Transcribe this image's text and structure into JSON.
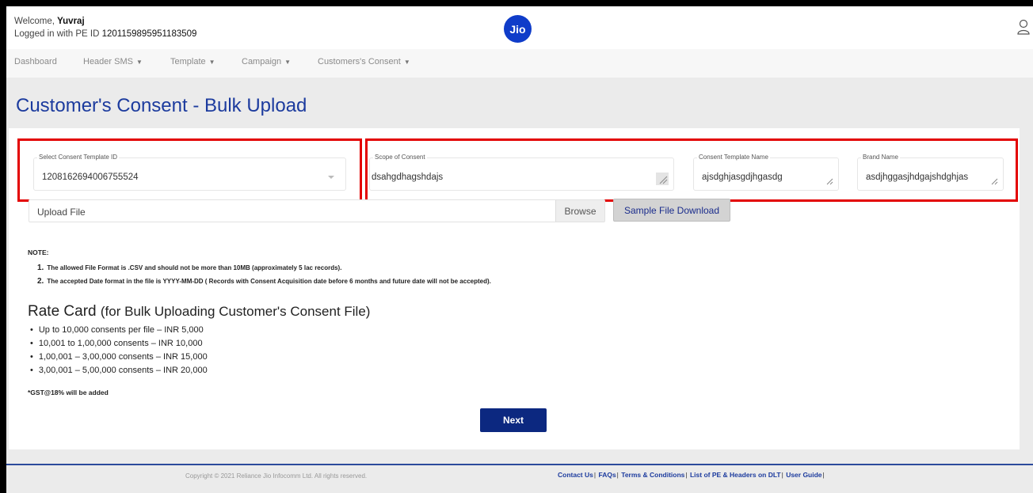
{
  "header": {
    "welcome_prefix": "Welcome,",
    "user_name": "Yuvraj",
    "pe_prefix": "Logged in with PE ID",
    "pe_id": "1201159895951183509",
    "logo_text": "Jio",
    "icons": {
      "logo": "jio-logo",
      "user": "user-icon"
    }
  },
  "nav": {
    "items": [
      {
        "label": "Dashboard",
        "has_caret": false
      },
      {
        "label": "Header SMS",
        "has_caret": true
      },
      {
        "label": "Template",
        "has_caret": true
      },
      {
        "label": "Campaign",
        "has_caret": true
      },
      {
        "label": "Customers's Consent",
        "has_caret": true
      }
    ],
    "caret_glyph": "▼"
  },
  "page": {
    "title": "Customer's Consent - Bulk Upload"
  },
  "form": {
    "template_id": {
      "label": "Select Consent Template ID",
      "value": "1208162694006755524"
    },
    "scope": {
      "label": "Scope of Consent",
      "value": "dsahgdhagshdajs"
    },
    "template_name": {
      "label": "Consent Template Name",
      "value": "ajsdghjasgdjhgasdg"
    },
    "brand_name": {
      "label": "Brand Name",
      "value": "asdjhggasjhdgajshdghjas"
    },
    "upload_label": "Upload File",
    "browse_label": "Browse",
    "sample_label": "Sample File Download",
    "highlight_color": "#e30000"
  },
  "notes": {
    "title": "NOTE:",
    "items": [
      {
        "num": "1.",
        "text": "The allowed File Format is .CSV and should not be more than 10MB (approximately 5 lac records)."
      },
      {
        "num": "2.",
        "text": "The accepted Date format in the file is YYYY-MM-DD ( Records with Consent Acquisition date before 6 months and future date will not be accepted)."
      }
    ]
  },
  "rate_card": {
    "title": "Rate Card",
    "subtitle": "(for Bulk Uploading Customer's Consent File)",
    "items": [
      "Up to 10,000 consents per file – INR 5,000",
      "10,001 to 1,00,000 consents – INR 10,000",
      "1,00,001 – 3,00,000 consents – INR 15,000",
      "3,00,001 – 5,00,000 consents – INR 20,000"
    ],
    "gst_note": "*GST@18% will be added"
  },
  "actions": {
    "next_label": "Next"
  },
  "footer": {
    "copyright": "Copyright © 2021 Reliance Jio Infocomm Ltd. All rights reserved.",
    "links": [
      "Contact Us",
      "FAQs",
      "Terms & Conditions",
      "List of PE & Headers on DLT",
      "User Guide"
    ]
  },
  "colors": {
    "brand_blue": "#0f3cc9",
    "title_blue": "#1c3b9e",
    "button_navy": "#0c2880"
  }
}
